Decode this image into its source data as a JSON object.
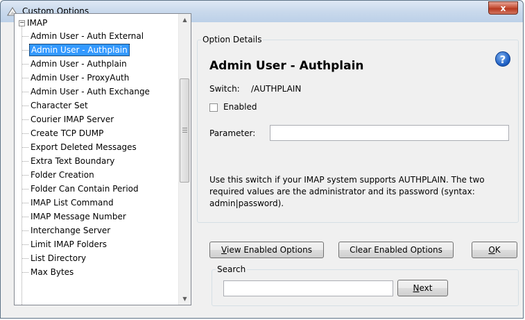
{
  "window": {
    "title": "Custom Options",
    "close_glyph": "x"
  },
  "tree": {
    "root_label": "IMAP",
    "expander_glyph": "−",
    "items": [
      "Admin User - Auth External",
      "Admin User - Authplain",
      "Admin User - Authplain",
      "Admin User - ProxyAuth",
      "Admin User - Auth Exchange",
      "Character Set",
      "Courier IMAP Server",
      "Create TCP DUMP",
      "Export Deleted Messages",
      "Extra Text Boundary",
      "Folder Creation",
      "Folder Can Contain Period",
      "IMAP List Command",
      "IMAP Message Number",
      "Interchange Server",
      "Limit IMAP Folders",
      "List Directory",
      "Max Bytes"
    ],
    "selected_index": 1
  },
  "option_details": {
    "legend": "Option Details",
    "help_glyph": "?",
    "title": "Admin User - Authplain",
    "switch_label": "Switch:",
    "switch_value": "/AUTHPLAIN",
    "enabled_label": "Enabled",
    "enabled_checked": false,
    "parameter_label": "Parameter:",
    "parameter_value": "",
    "description": "Use this switch if your IMAP system supports AUTHPLAIN. The two required values are the administrator and its password (syntax: admin|password)."
  },
  "buttons": {
    "view_enabled_first": "V",
    "view_enabled_rest": "iew Enabled Options",
    "clear_enabled": "Clear Enabled Options",
    "ok_first": "O",
    "ok_rest": "K"
  },
  "search": {
    "legend": "Search",
    "value": "",
    "next_first": "N",
    "next_rest": "ext"
  }
}
